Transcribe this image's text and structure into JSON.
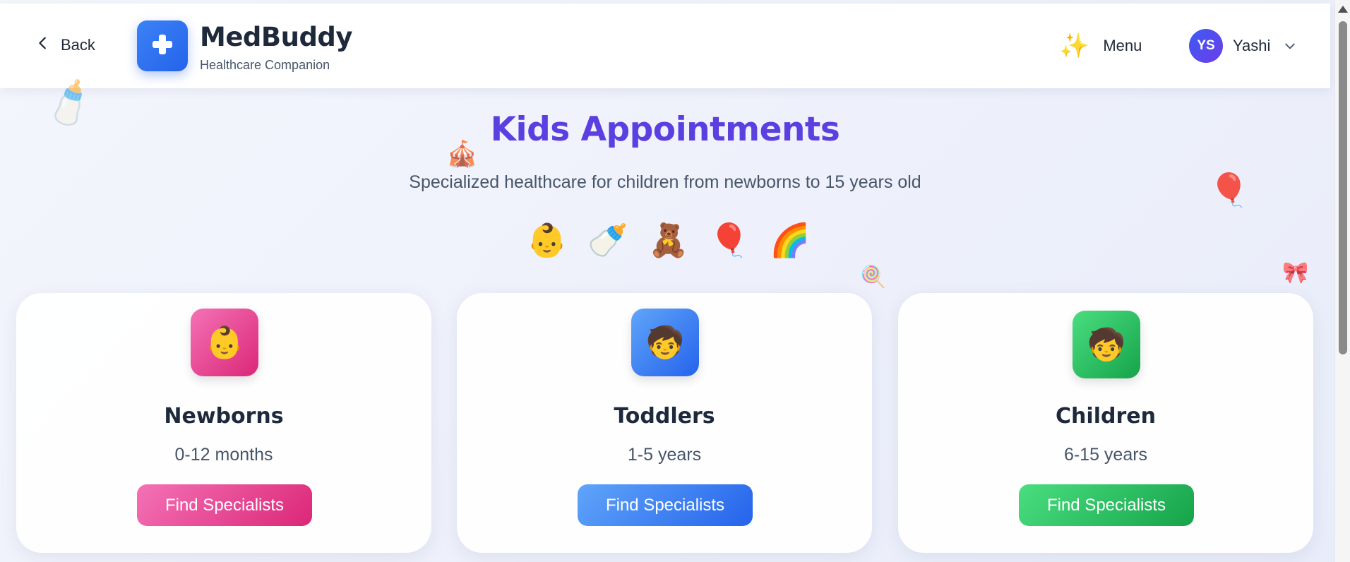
{
  "header": {
    "back_label": "Back",
    "brand_name": "MedBuddy",
    "brand_sub": "Healthcare Companion",
    "menu_label": "Menu",
    "user": {
      "initials": "YS",
      "name": "Yashi"
    }
  },
  "page": {
    "title": "Kids Appointments",
    "subtitle": "Specialized healthcare for children from newborns to 15 years old",
    "emoji_row": [
      "👶",
      "🍼",
      "🧸",
      "🎈",
      "🌈"
    ]
  },
  "decorations": {
    "bottle": "🍼",
    "tent": "🎪",
    "balloon": "🎈",
    "lollipop": "🍭",
    "ribbon": "🎀"
  },
  "cards": [
    {
      "icon": "👶",
      "title": "Newborns",
      "range": "0-12 months",
      "button": "Find Specialists"
    },
    {
      "icon": "🧒",
      "title": "Toddlers",
      "range": "1-5 years",
      "button": "Find Specialists"
    },
    {
      "icon": "🧒",
      "title": "Children",
      "range": "6-15 years",
      "button": "Find Specialists"
    }
  ],
  "colors": {
    "newborns": "#ec4899",
    "toddlers": "#3b82f6",
    "children": "#22c55e",
    "title": "#5b3fe0",
    "brand": "#2563eb"
  }
}
